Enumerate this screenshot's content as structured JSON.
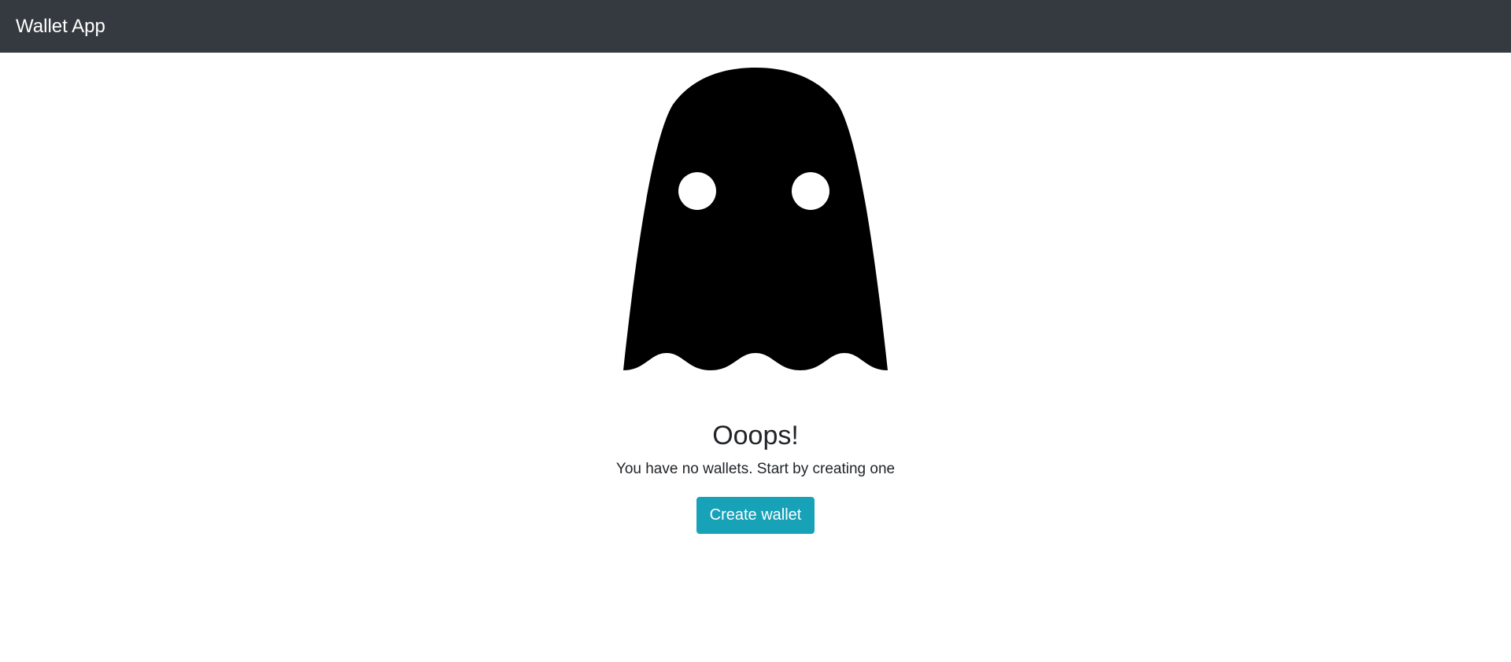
{
  "navbar": {
    "brand": "Wallet App",
    "background": "#343a40"
  },
  "empty_state": {
    "illustration": "ghost-icon",
    "title": "Ooops!",
    "message": "You have no wallets. Start by creating one",
    "create_button_label": "Create wallet",
    "button_color": "#17a2b8"
  }
}
